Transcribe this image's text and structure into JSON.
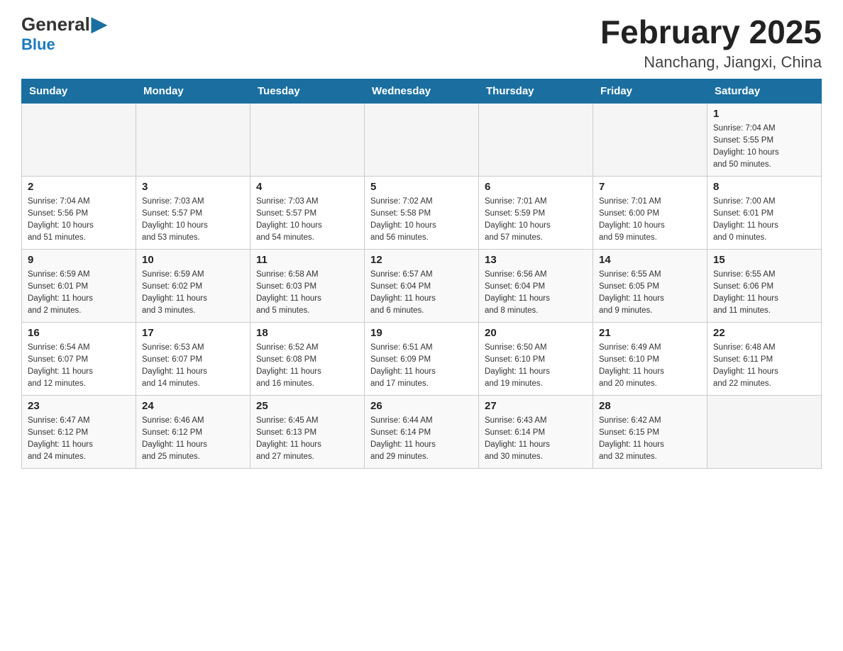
{
  "header": {
    "logo_general": "General",
    "logo_blue": "Blue",
    "title": "February 2025",
    "subtitle": "Nanchang, Jiangxi, China"
  },
  "calendar": {
    "weekdays": [
      "Sunday",
      "Monday",
      "Tuesday",
      "Wednesday",
      "Thursday",
      "Friday",
      "Saturday"
    ],
    "weeks": [
      [
        {
          "day": "",
          "info": ""
        },
        {
          "day": "",
          "info": ""
        },
        {
          "day": "",
          "info": ""
        },
        {
          "day": "",
          "info": ""
        },
        {
          "day": "",
          "info": ""
        },
        {
          "day": "",
          "info": ""
        },
        {
          "day": "1",
          "info": "Sunrise: 7:04 AM\nSunset: 5:55 PM\nDaylight: 10 hours\nand 50 minutes."
        }
      ],
      [
        {
          "day": "2",
          "info": "Sunrise: 7:04 AM\nSunset: 5:56 PM\nDaylight: 10 hours\nand 51 minutes."
        },
        {
          "day": "3",
          "info": "Sunrise: 7:03 AM\nSunset: 5:57 PM\nDaylight: 10 hours\nand 53 minutes."
        },
        {
          "day": "4",
          "info": "Sunrise: 7:03 AM\nSunset: 5:57 PM\nDaylight: 10 hours\nand 54 minutes."
        },
        {
          "day": "5",
          "info": "Sunrise: 7:02 AM\nSunset: 5:58 PM\nDaylight: 10 hours\nand 56 minutes."
        },
        {
          "day": "6",
          "info": "Sunrise: 7:01 AM\nSunset: 5:59 PM\nDaylight: 10 hours\nand 57 minutes."
        },
        {
          "day": "7",
          "info": "Sunrise: 7:01 AM\nSunset: 6:00 PM\nDaylight: 10 hours\nand 59 minutes."
        },
        {
          "day": "8",
          "info": "Sunrise: 7:00 AM\nSunset: 6:01 PM\nDaylight: 11 hours\nand 0 minutes."
        }
      ],
      [
        {
          "day": "9",
          "info": "Sunrise: 6:59 AM\nSunset: 6:01 PM\nDaylight: 11 hours\nand 2 minutes."
        },
        {
          "day": "10",
          "info": "Sunrise: 6:59 AM\nSunset: 6:02 PM\nDaylight: 11 hours\nand 3 minutes."
        },
        {
          "day": "11",
          "info": "Sunrise: 6:58 AM\nSunset: 6:03 PM\nDaylight: 11 hours\nand 5 minutes."
        },
        {
          "day": "12",
          "info": "Sunrise: 6:57 AM\nSunset: 6:04 PM\nDaylight: 11 hours\nand 6 minutes."
        },
        {
          "day": "13",
          "info": "Sunrise: 6:56 AM\nSunset: 6:04 PM\nDaylight: 11 hours\nand 8 minutes."
        },
        {
          "day": "14",
          "info": "Sunrise: 6:55 AM\nSunset: 6:05 PM\nDaylight: 11 hours\nand 9 minutes."
        },
        {
          "day": "15",
          "info": "Sunrise: 6:55 AM\nSunset: 6:06 PM\nDaylight: 11 hours\nand 11 minutes."
        }
      ],
      [
        {
          "day": "16",
          "info": "Sunrise: 6:54 AM\nSunset: 6:07 PM\nDaylight: 11 hours\nand 12 minutes."
        },
        {
          "day": "17",
          "info": "Sunrise: 6:53 AM\nSunset: 6:07 PM\nDaylight: 11 hours\nand 14 minutes."
        },
        {
          "day": "18",
          "info": "Sunrise: 6:52 AM\nSunset: 6:08 PM\nDaylight: 11 hours\nand 16 minutes."
        },
        {
          "day": "19",
          "info": "Sunrise: 6:51 AM\nSunset: 6:09 PM\nDaylight: 11 hours\nand 17 minutes."
        },
        {
          "day": "20",
          "info": "Sunrise: 6:50 AM\nSunset: 6:10 PM\nDaylight: 11 hours\nand 19 minutes."
        },
        {
          "day": "21",
          "info": "Sunrise: 6:49 AM\nSunset: 6:10 PM\nDaylight: 11 hours\nand 20 minutes."
        },
        {
          "day": "22",
          "info": "Sunrise: 6:48 AM\nSunset: 6:11 PM\nDaylight: 11 hours\nand 22 minutes."
        }
      ],
      [
        {
          "day": "23",
          "info": "Sunrise: 6:47 AM\nSunset: 6:12 PM\nDaylight: 11 hours\nand 24 minutes."
        },
        {
          "day": "24",
          "info": "Sunrise: 6:46 AM\nSunset: 6:12 PM\nDaylight: 11 hours\nand 25 minutes."
        },
        {
          "day": "25",
          "info": "Sunrise: 6:45 AM\nSunset: 6:13 PM\nDaylight: 11 hours\nand 27 minutes."
        },
        {
          "day": "26",
          "info": "Sunrise: 6:44 AM\nSunset: 6:14 PM\nDaylight: 11 hours\nand 29 minutes."
        },
        {
          "day": "27",
          "info": "Sunrise: 6:43 AM\nSunset: 6:14 PM\nDaylight: 11 hours\nand 30 minutes."
        },
        {
          "day": "28",
          "info": "Sunrise: 6:42 AM\nSunset: 6:15 PM\nDaylight: 11 hours\nand 32 minutes."
        },
        {
          "day": "",
          "info": ""
        }
      ]
    ]
  }
}
